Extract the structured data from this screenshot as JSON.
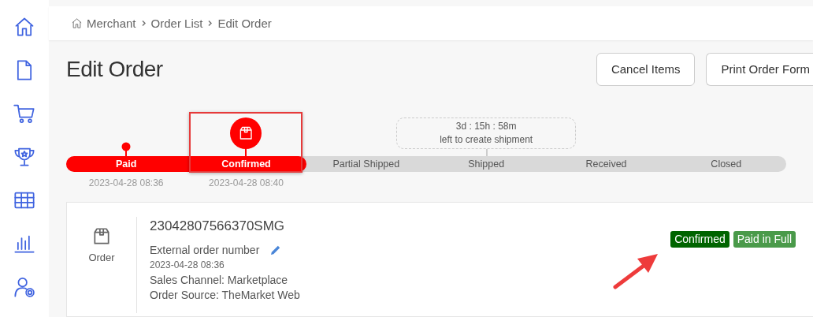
{
  "sidebar": {
    "items": [
      {
        "kind": "home"
      },
      {
        "kind": "document"
      },
      {
        "kind": "cart"
      },
      {
        "kind": "trophy"
      },
      {
        "kind": "grid"
      },
      {
        "kind": "chart"
      },
      {
        "kind": "user-settings"
      }
    ]
  },
  "breadcrumb": [
    "Merchant",
    "Order List",
    "Edit Order"
  ],
  "title": "Edit Order",
  "buttons": [
    "Cancel Items",
    "Print Order Form"
  ],
  "timeline": {
    "steps": [
      {
        "label": "Paid",
        "done": true,
        "current": false,
        "date": "2023-04-28 08:36"
      },
      {
        "label": "Confirmed",
        "done": true,
        "current": true,
        "date": "2023-04-28 08:40"
      },
      {
        "label": "Partial Shipped",
        "done": false,
        "current": false
      },
      {
        "label": "Shipped",
        "done": false,
        "current": false,
        "countdown": {
          "time": "3d : 15h : 58m",
          "note": "left to create shipment"
        }
      },
      {
        "label": "Received",
        "done": false,
        "current": false
      },
      {
        "label": "Closed",
        "done": false,
        "current": false
      }
    ]
  },
  "order": {
    "type_label": "Order",
    "number": "23042807566370SMG",
    "external_label": "External order number",
    "date": "2023-04-28 08:36",
    "lines": [
      "Sales Channel: Marketplace",
      "Order Source: TheMarket Web"
    ],
    "badges": [
      {
        "label": "Confirmed",
        "color": "#006400"
      },
      {
        "label": "Paid in Full",
        "color": "#4a9a4a"
      }
    ]
  }
}
